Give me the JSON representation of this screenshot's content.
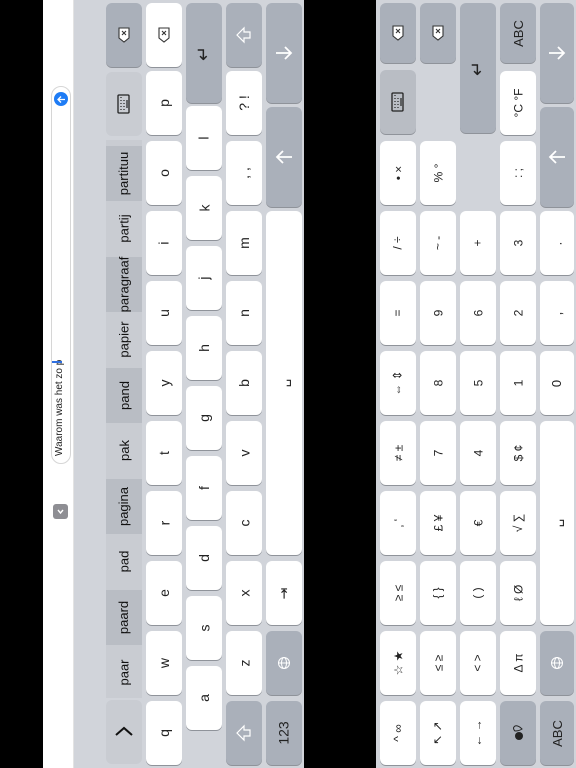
{
  "text_field": {
    "value": "Waarom was het zo p"
  },
  "predictions": [
    "paar",
    "paard",
    "pad",
    "pagina",
    "pak",
    "pand",
    "papier",
    "paragraaf",
    "partij",
    "partituu"
  ],
  "left_keyboard": {
    "row1": [
      "q",
      "w",
      "e",
      "r",
      "t",
      "y",
      "u",
      "i",
      "o",
      "p"
    ],
    "row2": [
      "a",
      "s",
      "d",
      "f",
      "g",
      "h",
      "j",
      "k",
      "l"
    ],
    "row3": [
      "z",
      "x",
      "c",
      "v",
      "b",
      "n",
      "m",
      ", ,",
      "? !"
    ],
    "row4": [
      "123",
      "⇥"
    ],
    "backspace": "⌫",
    "enter": "↵"
  },
  "right_keyboard": {
    "col1": [
      "^ ∞",
      "☆ ★",
      "≥ ≤",
      "‚ ‘",
      "≠ ±",
      "⇔ ⇕",
      "=",
      "/ ÷",
      "• ×"
    ],
    "col2": [
      "↖ ↗",
      "≤ ≥",
      "{ }",
      "£ ¥",
      "7",
      "8",
      "9",
      "~ -",
      "% °"
    ],
    "col3": [
      "← →",
      "< >",
      "( )",
      "€",
      "4",
      "5",
      "6",
      "+"
    ],
    "col4": [
      "Δ π",
      "ℓ Ø",
      "√ ∑",
      "$ ¢",
      "1",
      "2",
      "3",
      ": ;",
      "°C °F"
    ],
    "col5": [
      "0",
      ",",
      "."
    ],
    "abc_label": "ABC",
    "arrow_up": "↑",
    "arrow_down": "↓"
  }
}
